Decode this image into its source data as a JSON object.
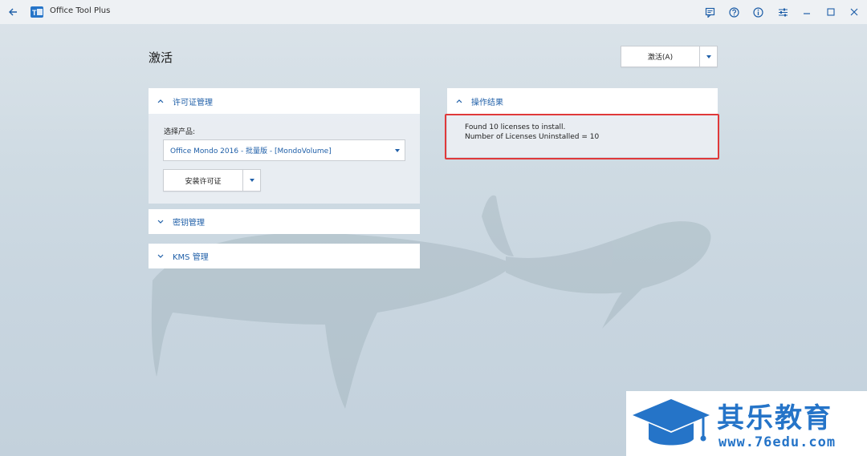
{
  "window": {
    "app_title": "Office Tool Plus",
    "logo_glyph": "T"
  },
  "icons": {
    "back": "back-arrow-icon",
    "feedback": "feedback-icon",
    "help": "help-icon",
    "info": "info-icon",
    "settings": "settings-sliders-icon",
    "minimize": "minimize-icon",
    "maximize": "maximize-icon",
    "close": "close-icon"
  },
  "page": {
    "title": "激活"
  },
  "activate_button": {
    "label": "激活(A)"
  },
  "license_panel": {
    "header": "许可证管理",
    "product_label": "选择产品:",
    "product_value": "Office Mondo 2016 - 批量版 - [MondoVolume]",
    "install_button": "安装许可证"
  },
  "key_panel": {
    "header": "密钥管理"
  },
  "kms_panel": {
    "header": "KMS 管理"
  },
  "result_panel": {
    "header": "操作结果",
    "lines": [
      "Found 10 licenses to install.",
      "Number of Licenses Uninstalled = 10"
    ]
  },
  "watermark": {
    "name": "其乐教育",
    "url": "www.76edu.com"
  },
  "colors": {
    "accent": "#1f5fa8",
    "highlight": "#e0393a",
    "watermark": "#2574c8"
  }
}
